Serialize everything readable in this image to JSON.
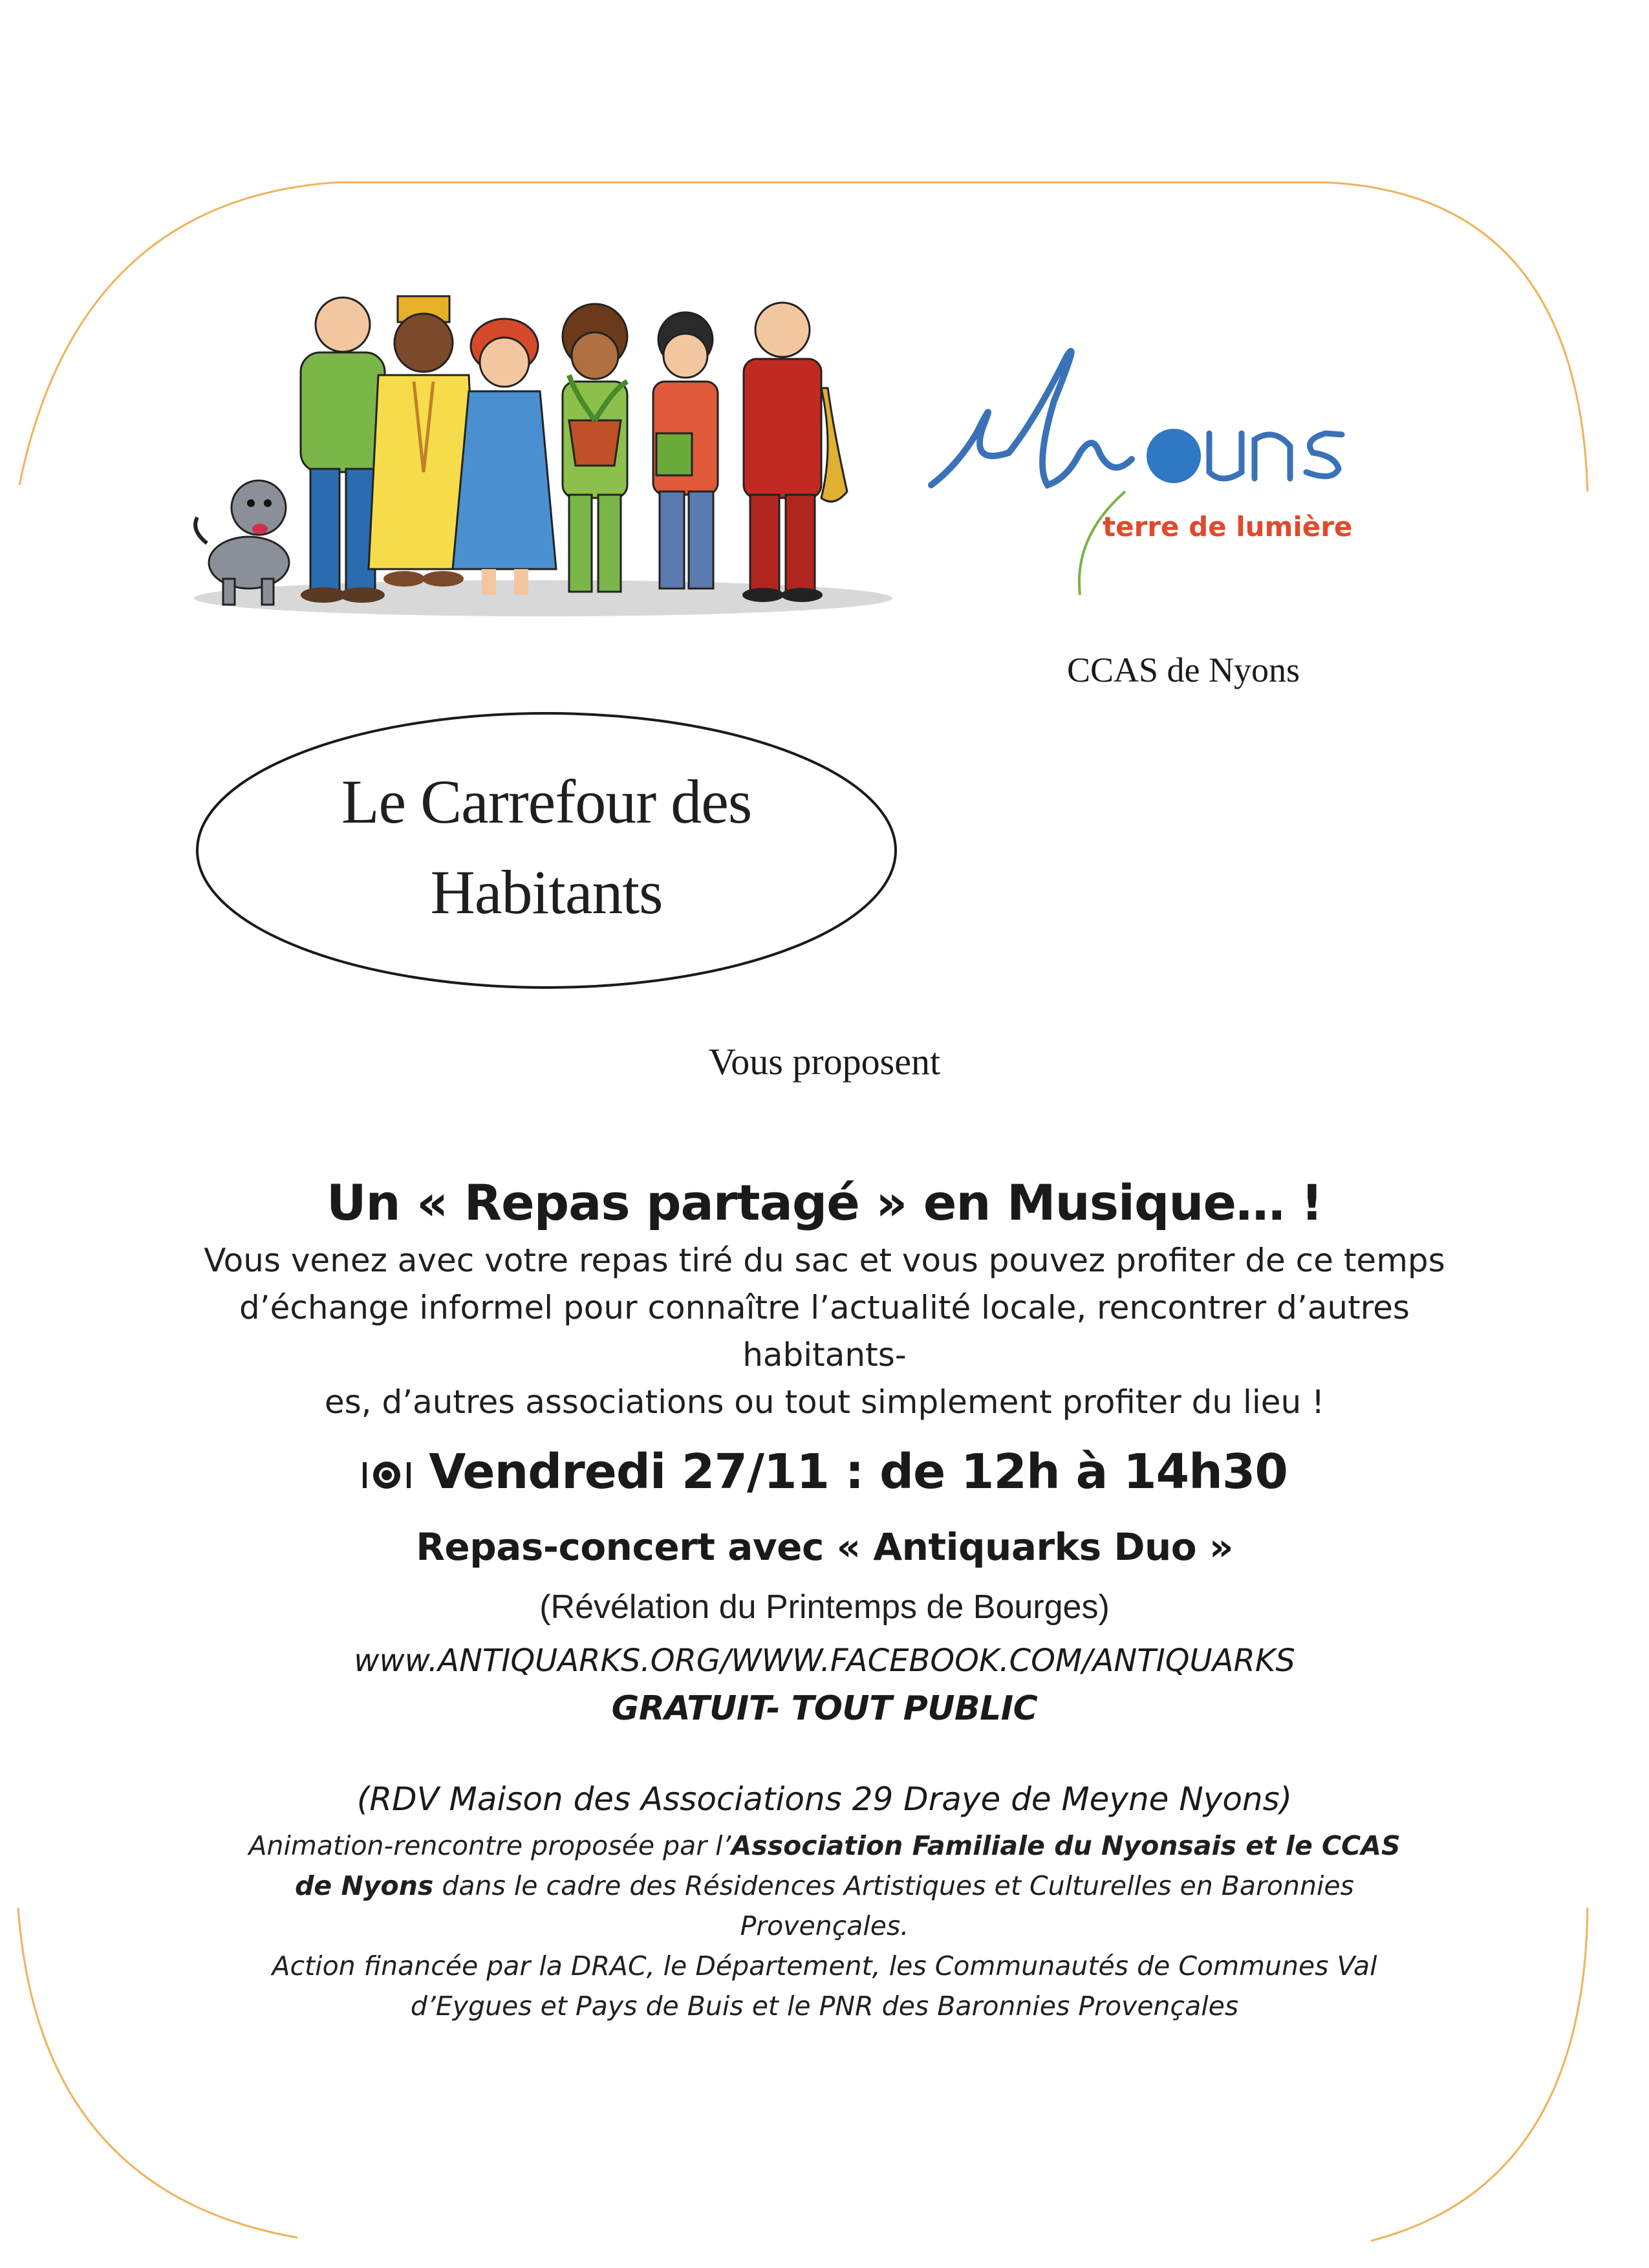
{
  "logo": {
    "town": "Nyons",
    "tagline": "terre de lumière"
  },
  "ccas": "CCAS de Nyons",
  "oval": {
    "line1": "Le Carrefour des",
    "line2": "Habitants"
  },
  "proposent": "Vous proposent",
  "event": {
    "title": "Un « Repas partagé » en Musique… !",
    "desc_line1": "Vous venez avec votre repas tiré du sac et vous pouvez profiter de ce temps",
    "desc_line2": "d’échange informel pour connaître l’actualité locale, rencontrer d’autres habitants-",
    "desc_line3": "es, d’autres associations ou tout simplement profiter du lieu !"
  },
  "schedule": {
    "date": "Vendredi 27/11 : de 12h à 14h30",
    "concert": "Repas-concert avec « Antiquarks Duo »",
    "revelation": "(Révélation du Printemps de Bourges)",
    "links": "www.ANTIQUARKS.ORG/WWW.FACEBOOK.COM/ANTIQUARKS",
    "price": "GRATUIT- TOUT PUBLIC"
  },
  "footer": {
    "rdv": "(RDV Maison des Associations  29 Draye de Meyne    Nyons)",
    "credits_a": "Animation-rencontre proposée  par l’",
    "credits_b": "Association Familiale du Nyonsais et le CCAS de Nyons",
    "credits_c": "  dans le cadre des Résidences Artistiques et Culturelles en Baronnies Provençales.",
    "credits_line3": "Action financée par la DRAC, le Département, les Communautés de Communes Val",
    "credits_line4": "d’Eygues et Pays de Buis et le PNR des Baronnies Provençales"
  },
  "colors": {
    "frame": "#f0b25a",
    "logo_blue": "#3a72b8",
    "logo_dot": "#2f78c4",
    "logo_red": "#e04a2a",
    "logo_green": "#78b24a"
  }
}
